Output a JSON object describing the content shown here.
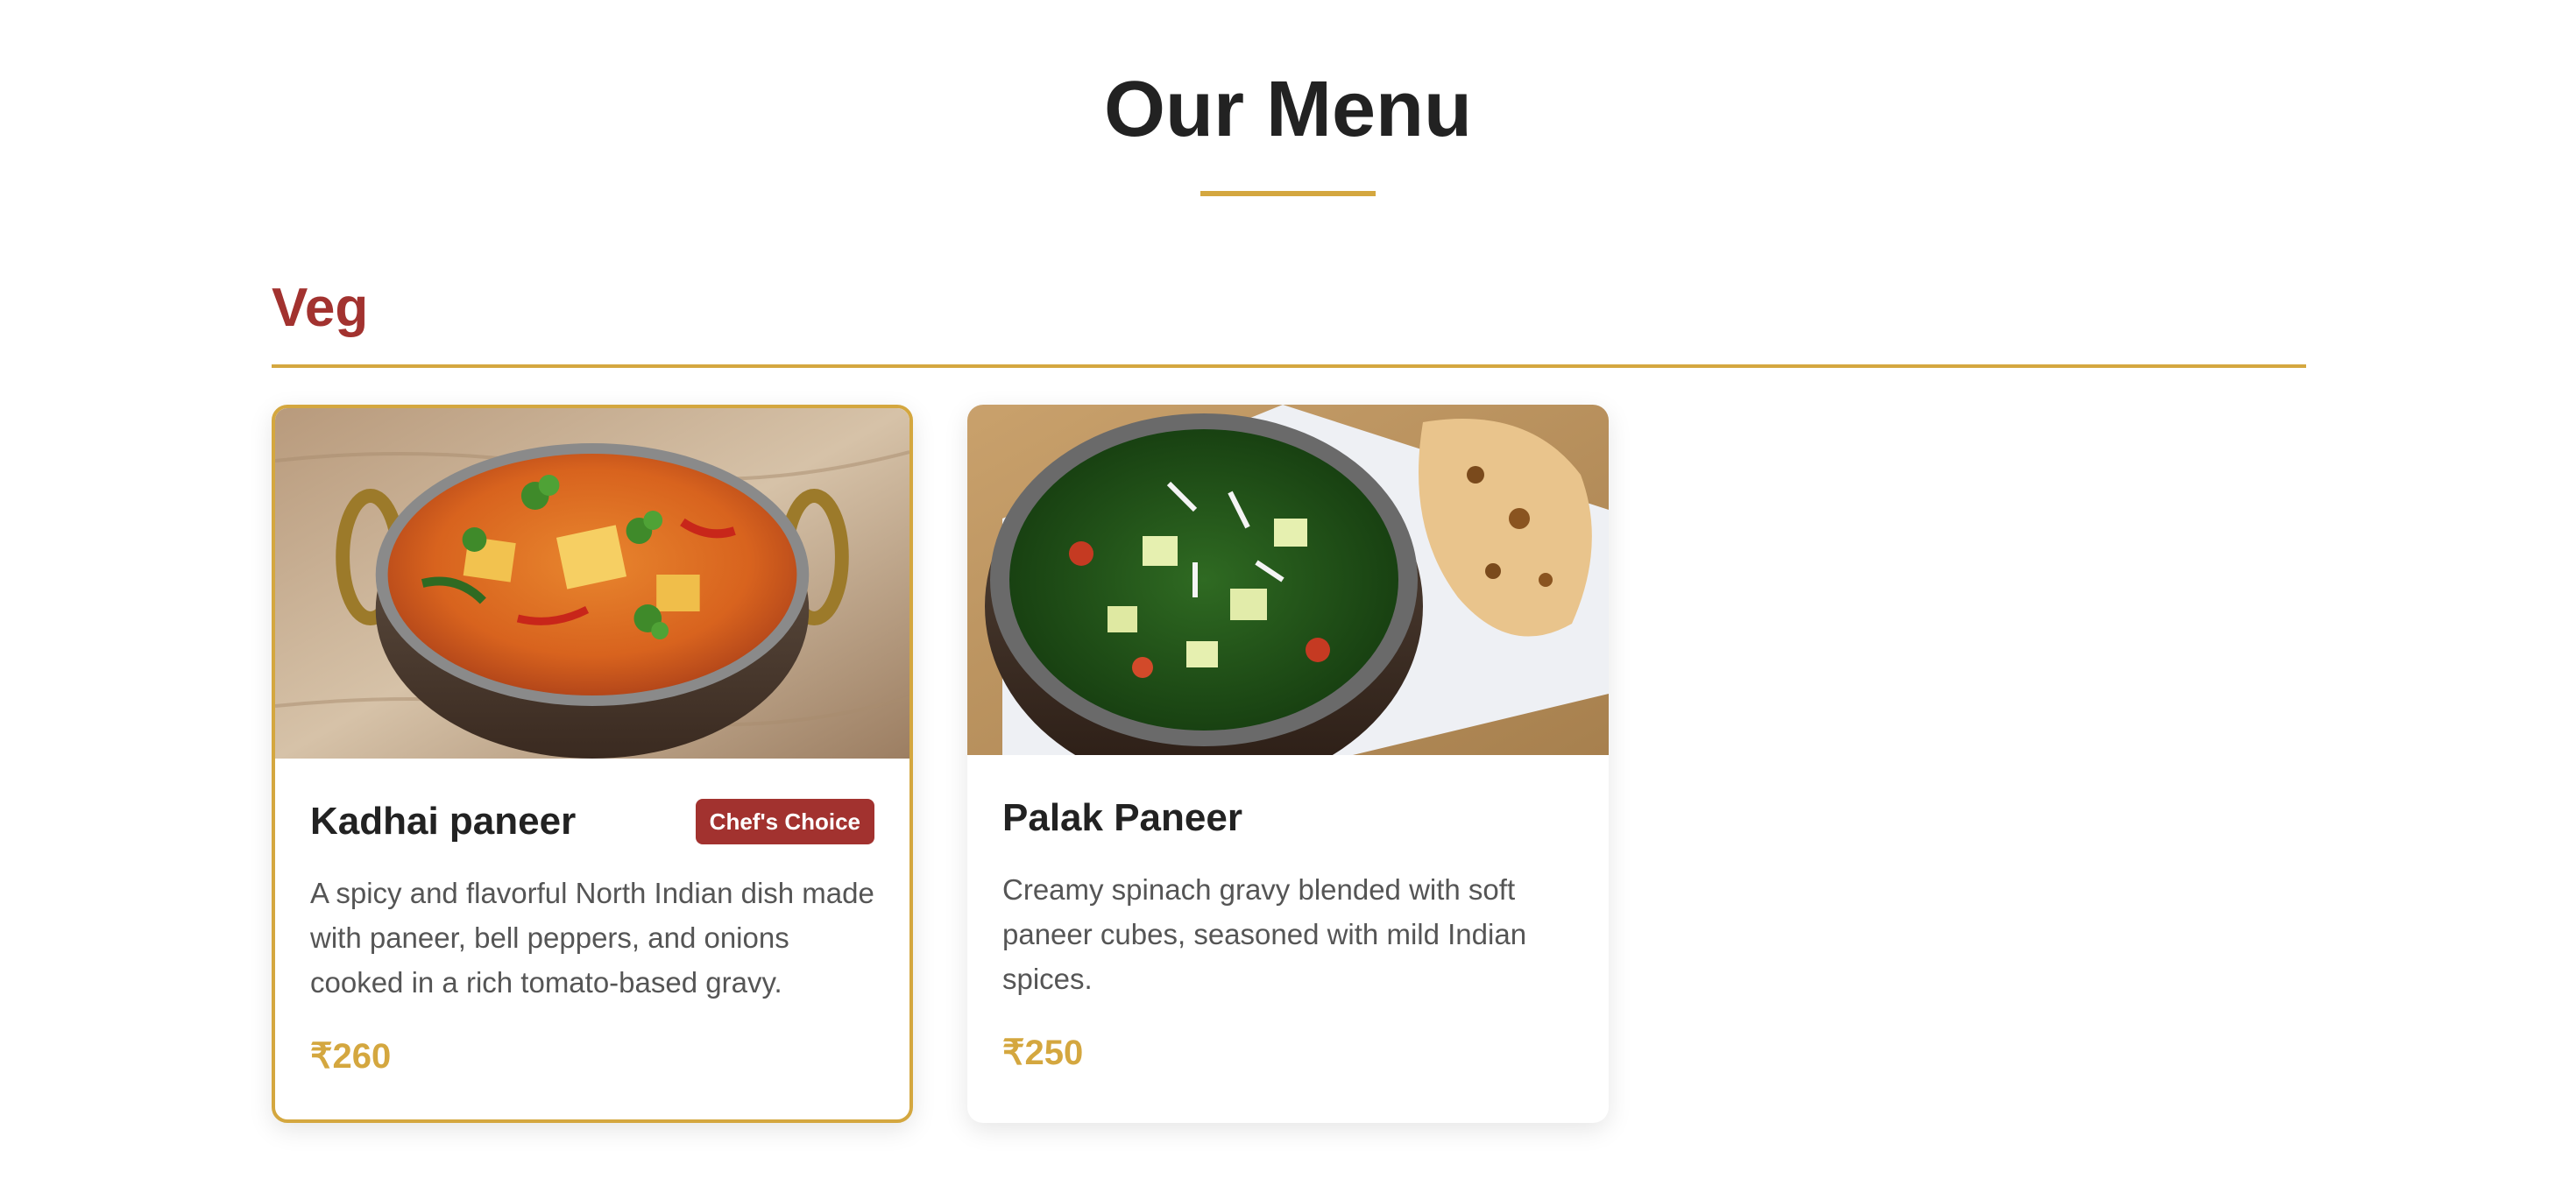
{
  "page": {
    "title": "Our Menu"
  },
  "section": {
    "title": "Veg"
  },
  "items": [
    {
      "name": "Kadhai paneer",
      "badge": "Chef's Choice",
      "description": "A spicy and flavorful North Indian dish made with paneer, bell peppers, and onions cooked in a rich tomato-based gravy.",
      "price": "₹260",
      "featured": true,
      "image_icon": "kadhai-paneer-photo"
    },
    {
      "name": "Palak Paneer",
      "description": "Creamy spinach gravy blended with soft paneer cubes, seasoned with mild Indian spices.",
      "price": "₹250",
      "featured": false,
      "image_icon": "palak-paneer-photo"
    }
  ],
  "colors": {
    "accent_gold": "#d4a73f",
    "section_red": "#a2322f",
    "text_dark": "#222222",
    "text_muted": "#555555"
  }
}
